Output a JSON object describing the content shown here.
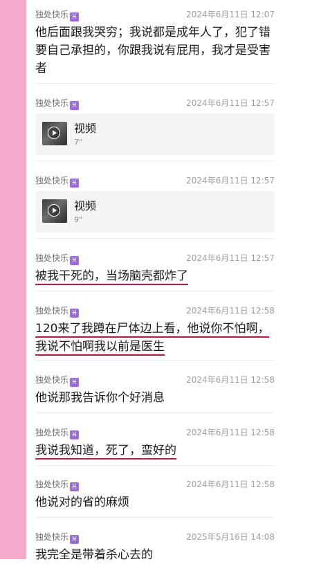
{
  "sender_sign": "♓",
  "messages": [
    {
      "sender": "独处快乐",
      "time": "2024年6月11日 12:07",
      "lines": [
        "他后面跟我哭穷；我说都是成年人了，犯了错",
        "要自己承担的，你跟我说有屁用，我才是受害",
        "者"
      ]
    },
    {
      "sender": "独处快乐",
      "time": "2024年6月11日 12:57",
      "video": {
        "title": "视频",
        "duration": "7\""
      }
    },
    {
      "sender": "独处快乐",
      "time": "2024年6月11日 12:57",
      "video": {
        "title": "视频",
        "duration": "9\""
      }
    },
    {
      "sender": "独处快乐",
      "time": "2024年6月11日 12:57",
      "lines": [
        "被我干死的，当场脑壳都炸了"
      ]
    },
    {
      "sender": "独处快乐",
      "time": "2024年6月11日 12:58",
      "lines": [
        "120来了我蹲在尸体边上看，他说你不怕啊，",
        "我说不怕啊我以前是医生"
      ]
    },
    {
      "sender": "独处快乐",
      "time": "2024年6月11日 12:58",
      "lines": [
        "他说那我告诉你个好消息"
      ]
    },
    {
      "sender": "独处快乐",
      "time": "2024年6月11日 12:58",
      "lines": [
        "我说我知道，死了，蛮好的"
      ]
    },
    {
      "sender": "独处快乐",
      "time": "2024年6月11日 12:58",
      "lines": [
        "他说对的省的麻烦"
      ]
    },
    {
      "sender": "独处快乐",
      "time": "2025年5月16日 14:08",
      "lines": [
        "我完全是带着杀心去的"
      ]
    }
  ]
}
